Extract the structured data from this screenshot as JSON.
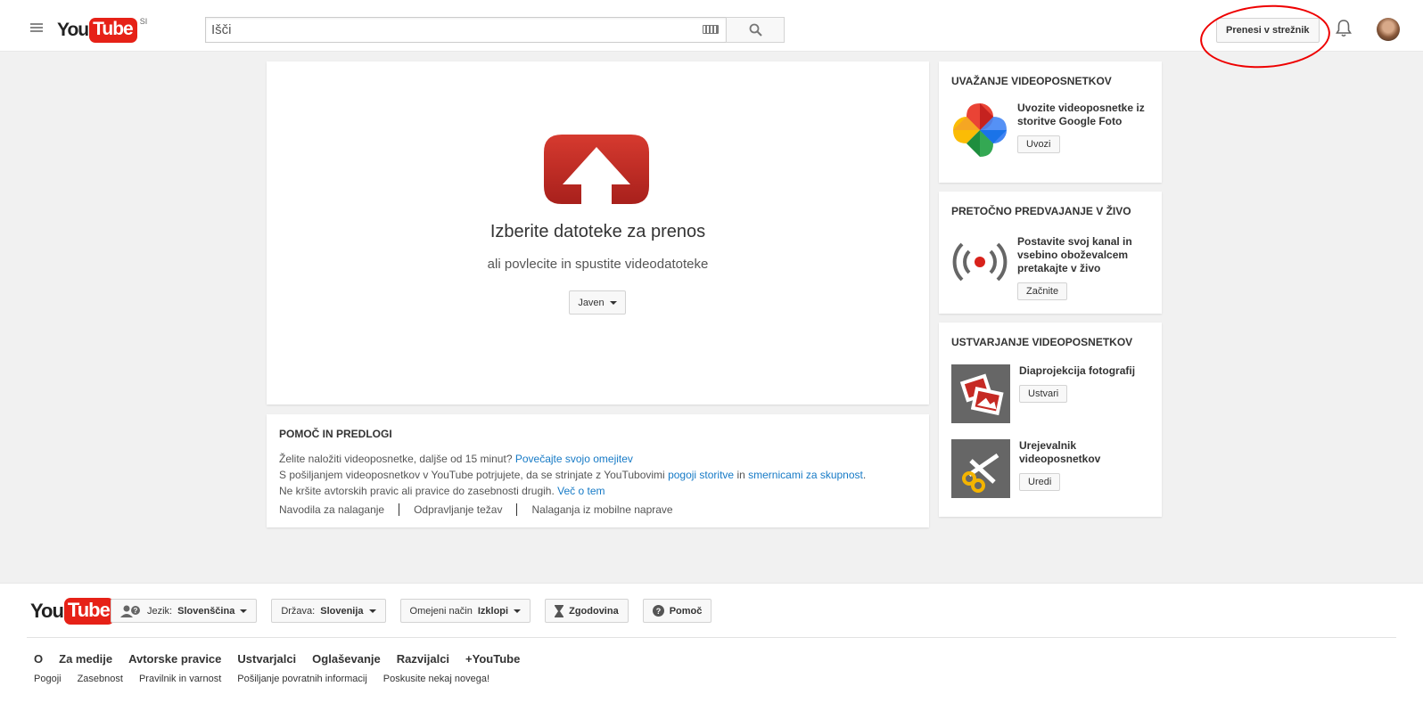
{
  "header": {
    "logo_you": "You",
    "logo_tube": "Tube",
    "logo_country": "SI",
    "search_placeholder": "Išči",
    "upload_label": "Prenesi v strežnik"
  },
  "upload": {
    "title": "Izberite datoteke za prenos",
    "subtitle": "ali povlecite in spustite videodatoteke",
    "privacy_label": "Javen"
  },
  "help": {
    "title": "POMOČ IN PREDLOGI",
    "line1_text": "Želite naložiti videoposnetke, daljše od 15 minut?",
    "line1_link": "Povečajte svojo omejitev",
    "line2_text_a": "S pošiljanjem videoposnetkov v YouTube potrjujete, da se strinjate z YouTubovimi",
    "line2_link_a": "pogoji storitve",
    "line2_text_b": "in",
    "line2_link_b": "smernicami za skupnost",
    "line2_text_c": ".",
    "line3_text": "Ne kršite avtorskih pravic ali pravice do zasebnosti drugih.",
    "line3_link": "Več o tem",
    "links": [
      "Navodila za nalaganje",
      "Odpravljanje težav",
      "Nalaganja iz mobilne naprave"
    ]
  },
  "sidebar": {
    "import": {
      "title": "UVAŽANJE VIDEOPOSNETKOV",
      "text": "Uvozite videoposnetke iz storitve Google Foto",
      "button": "Uvozi"
    },
    "live": {
      "title": "PRETOČNO PREDVAJANJE V ŽIVO",
      "text": "Postavite svoj kanal in vsebino oboževalcem pretakajte v živo",
      "button": "Začnite"
    },
    "create": {
      "title": "USTVARJANJE VIDEOPOSNETKOV",
      "slideshow_text": "Diaprojekcija fotografij",
      "slideshow_button": "Ustvari",
      "editor_text": "Urejevalnik videoposnetkov",
      "editor_button": "Uredi"
    }
  },
  "footer": {
    "language_prefix": "Jezik:",
    "language_value": "Slovenščina",
    "country_prefix": "Država:",
    "country_value": "Slovenija",
    "restricted_prefix": "Omejeni način",
    "restricted_value": "Izklopi",
    "history": "Zgodovina",
    "help": "Pomoč",
    "nav": [
      "O",
      "Za medije",
      "Avtorske pravice",
      "Ustvarjalci",
      "Oglaševanje",
      "Razvijalci",
      "+YouTube"
    ],
    "legal": [
      "Pogoji",
      "Zasebnost",
      "Pravilnik in varnost",
      "Pošiljanje povratnih informacij",
      "Poskusite nekaj novega!"
    ]
  },
  "colors": {
    "youtube_red": "#e62117",
    "upload_red": "#c62a24",
    "link_blue": "#167ac6",
    "annotation_red": "#ee0000"
  }
}
